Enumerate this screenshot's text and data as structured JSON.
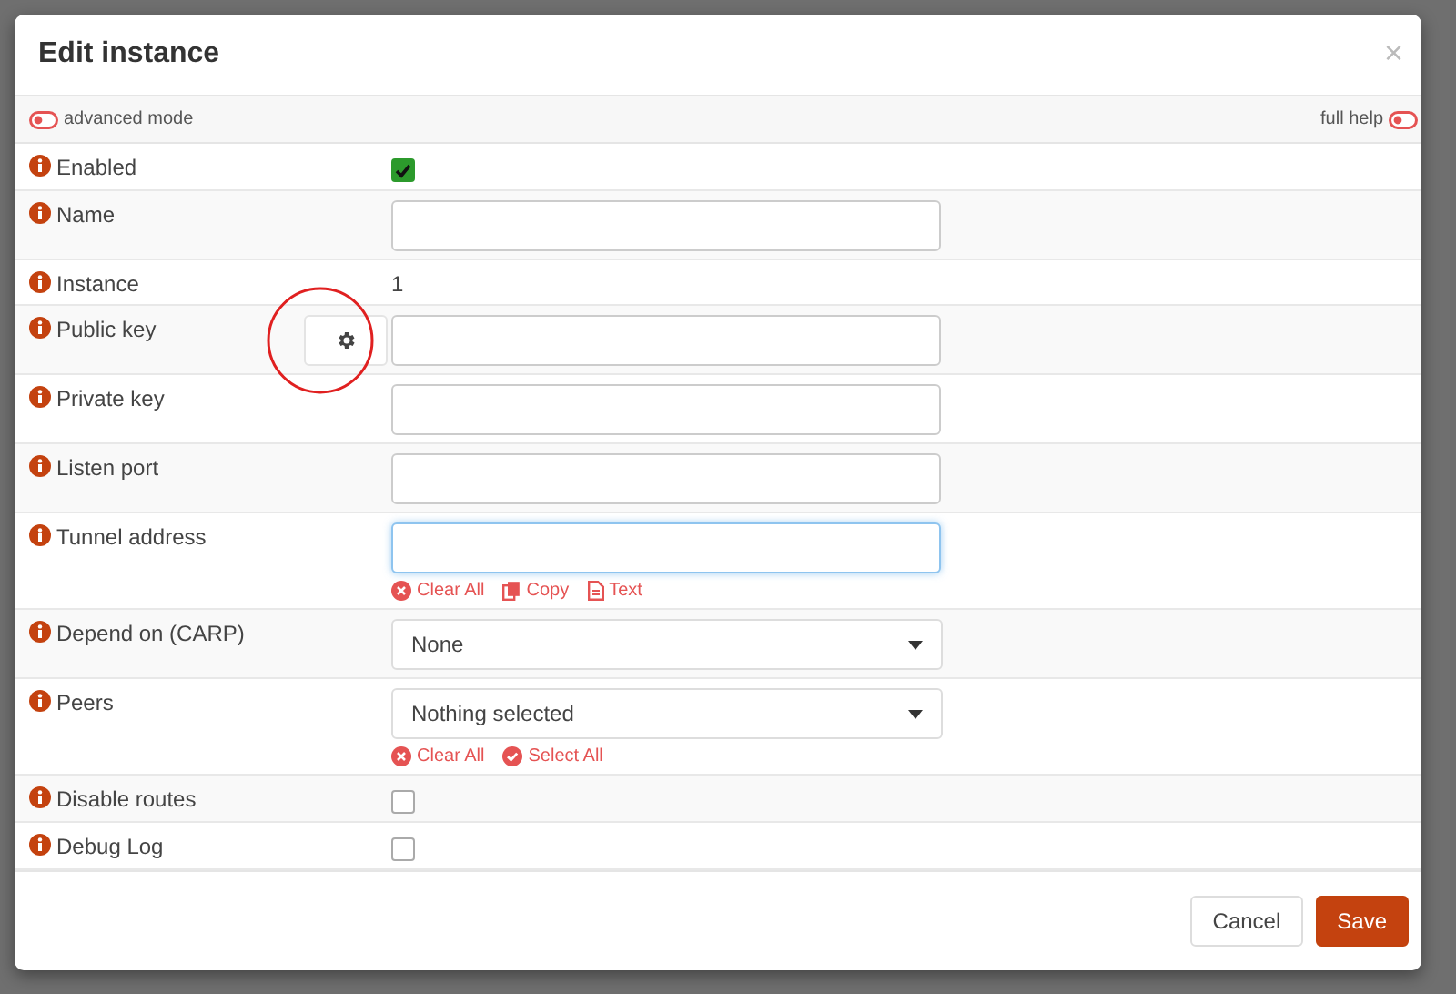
{
  "dialog": {
    "title": "Edit instance",
    "close": "×"
  },
  "toggles": {
    "left": {
      "label": "advanced mode",
      "on": false
    },
    "right": {
      "label": "full help",
      "on": false
    }
  },
  "fields": [
    {
      "kind": "checkbox",
      "label": "Enabled",
      "checked": true
    },
    {
      "kind": "text",
      "label": "Name",
      "focused": false
    },
    {
      "kind": "static",
      "label": "Instance",
      "value": "1"
    },
    {
      "kind": "text",
      "label": "Public key",
      "generate": true,
      "focused": false,
      "highlighted": true
    },
    {
      "kind": "text",
      "label": "Private key",
      "focused": false
    },
    {
      "kind": "text",
      "label": "Listen port",
      "focused": false
    },
    {
      "kind": "text",
      "label": "Tunnel address",
      "focused": true,
      "actions": [
        {
          "kind": "clear",
          "label": "Clear All"
        },
        {
          "kind": "copy",
          "label": "Copy"
        },
        {
          "kind": "text",
          "label": "Text"
        }
      ]
    },
    {
      "kind": "select",
      "label": "Depend on (CARP)",
      "value": "None"
    },
    {
      "kind": "select",
      "label": "Peers",
      "value": "Nothing selected",
      "actions": [
        {
          "kind": "clear",
          "label": "Clear All"
        },
        {
          "kind": "select",
          "label": "Select All"
        }
      ]
    },
    {
      "kind": "checkbox",
      "label": "Disable routes",
      "checked": false
    },
    {
      "kind": "checkbox",
      "label": "Debug Log",
      "checked": false
    }
  ],
  "buttons": [
    {
      "label": "Cancel",
      "primary": false
    },
    {
      "label": "Save",
      "primary": true
    }
  ]
}
